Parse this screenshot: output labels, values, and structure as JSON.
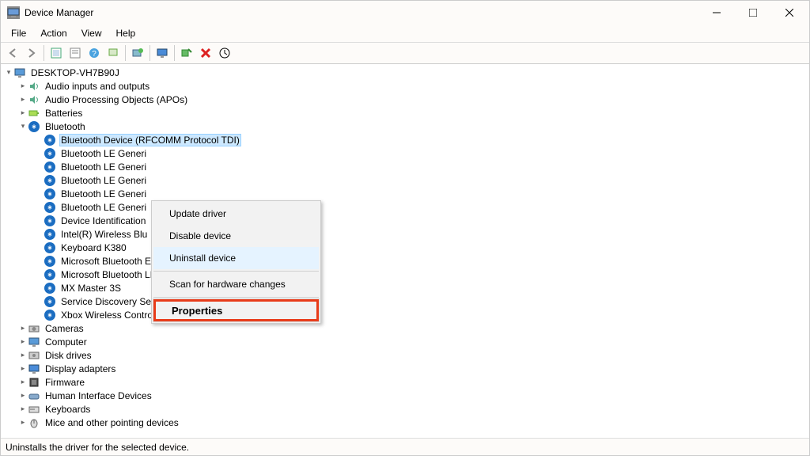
{
  "window_title": "Device Manager",
  "menus": [
    "File",
    "Action",
    "View",
    "Help"
  ],
  "toolbar_icons": [
    "back-icon",
    "forward-icon",
    "sep",
    "show-hidden-icon",
    "properties-icon",
    "help-icon",
    "sep",
    "devices-icon",
    "sep",
    "add-device-icon",
    "sep",
    "monitor-icon",
    "sep",
    "scan-icon",
    "uninstall-icon",
    "sep",
    "update-icon"
  ],
  "root_name": "DESKTOP-VH7B90J",
  "categories": [
    {
      "name": "Audio inputs and outputs",
      "icon": "audio",
      "expanded": false,
      "children": []
    },
    {
      "name": "Audio Processing Objects (APOs)",
      "icon": "audio",
      "expanded": false,
      "children": []
    },
    {
      "name": "Batteries",
      "icon": "battery",
      "expanded": false,
      "children": []
    },
    {
      "name": "Bluetooth",
      "icon": "bt",
      "expanded": true,
      "children": [
        {
          "name": "Bluetooth Device (RFCOMM Protocol TDI)",
          "icon": "bt",
          "selected": true
        },
        {
          "name": "Bluetooth LE Generi",
          "icon": "bt"
        },
        {
          "name": "Bluetooth LE Generi",
          "icon": "bt"
        },
        {
          "name": "Bluetooth LE Generi",
          "icon": "bt"
        },
        {
          "name": "Bluetooth LE Generi",
          "icon": "bt"
        },
        {
          "name": "Bluetooth LE Generi",
          "icon": "bt"
        },
        {
          "name": "Device Identification",
          "icon": "bt"
        },
        {
          "name": "Intel(R) Wireless Blu",
          "icon": "bt"
        },
        {
          "name": "Keyboard K380",
          "icon": "bt"
        },
        {
          "name": "Microsoft Bluetooth Enumerator",
          "icon": "bt"
        },
        {
          "name": "Microsoft Bluetooth LE Enumerator",
          "icon": "bt"
        },
        {
          "name": "MX Master 3S",
          "icon": "bt"
        },
        {
          "name": "Service Discovery Service",
          "icon": "bt"
        },
        {
          "name": "Xbox Wireless Controller",
          "icon": "bt"
        }
      ]
    },
    {
      "name": "Cameras",
      "icon": "camera",
      "expanded": false,
      "children": []
    },
    {
      "name": "Computer",
      "icon": "computer",
      "expanded": false,
      "children": []
    },
    {
      "name": "Disk drives",
      "icon": "disk",
      "expanded": false,
      "children": []
    },
    {
      "name": "Display adapters",
      "icon": "display",
      "expanded": false,
      "children": []
    },
    {
      "name": "Firmware",
      "icon": "firmware",
      "expanded": false,
      "children": []
    },
    {
      "name": "Human Interface Devices",
      "icon": "hid",
      "expanded": false,
      "children": []
    },
    {
      "name": "Keyboards",
      "icon": "keyboard",
      "expanded": false,
      "children": []
    },
    {
      "name": "Mice and other pointing devices",
      "icon": "mouse",
      "expanded": false,
      "children": []
    }
  ],
  "context_menu": [
    {
      "label": "Update driver",
      "type": "item"
    },
    {
      "label": "Disable device",
      "type": "item"
    },
    {
      "label": "Uninstall device",
      "type": "item",
      "hover": true
    },
    {
      "type": "sep"
    },
    {
      "label": "Scan for hardware changes",
      "type": "item"
    },
    {
      "type": "sep"
    },
    {
      "label": "Properties",
      "type": "item",
      "highlight": true
    }
  ],
  "status_text": "Uninstalls the driver for the selected device."
}
